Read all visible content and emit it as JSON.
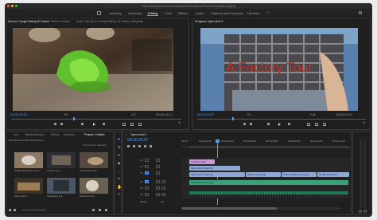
{
  "window": {
    "title": "/Users/Adobe/Documents/Adobe/Premiere Pro/11.0/Untitled.prproj"
  },
  "workspaces": [
    "Learning",
    "Assembly",
    "Editing",
    "Color",
    "Effects",
    "Audio",
    "Captions and Graphics",
    "Libraries"
  ],
  "active_workspace": "Editing",
  "source_panel": {
    "tabs": [
      "Source: Dough Mixing 4K Canon",
      "Effect Controls",
      "Audio Clip Mixer: Dough Mixing 4K Canon",
      "Metadata"
    ],
    "timecode_in": "00;00;06;20",
    "fit": "Fit",
    "scale": "1/2",
    "duration": "00;00;14;17"
  },
  "program_panel": {
    "tab": "Program: Open shot 0",
    "title_overlay": "A Factory Tour",
    "timecode_in": "00;00;03;07",
    "fit": "Fit",
    "scale": "Full",
    "duration": "00;00;15;10"
  },
  "project_panel": {
    "tabs": [
      "Info",
      "Media Browser",
      "Effects",
      "Libraries",
      "Project: Untitled"
    ],
    "path": "Workspaces/Untitled/Media Items",
    "count": "8 of 13 items selected",
    "items": [
      {
        "label": "Dough Mixing 4K Canon",
        "duration": "14;17"
      },
      {
        "label": "Factory Tour_ ...",
        "duration": "5;00"
      },
      {
        "label": "Kneading dough",
        "duration": "8;02"
      },
      {
        "label": "Open shot 0",
        "duration": "15;10"
      },
      {
        "label": "Packaging line",
        "duration": "6;11"
      },
      {
        "label": "Staff interview",
        "duration": "9;05"
      }
    ]
  },
  "timeline": {
    "tab": "Open shot 0",
    "timecode": "00;00;03;07",
    "ruler": [
      "00;00",
      "00;00;02;00",
      "00;00;04;00",
      "00;00;06;00",
      "00;00;08;00",
      "00;00;10;00",
      "00;00;12;00",
      "00;00;14;00"
    ],
    "tracks": [
      {
        "name": "V3"
      },
      {
        "name": "V2"
      },
      {
        "name": "V1"
      },
      {
        "name": "A1"
      },
      {
        "name": "A2"
      },
      {
        "name": "A3"
      }
    ],
    "clips": {
      "title": "A Factory Tour",
      "v2a": "Open shot 0.mp4 [V]",
      "v1a": "Open shot 0.mp4 [V]",
      "v1b": "Pastry making 4K",
      "v1c": "Pastry making 4K Canon",
      "v1d": "Dough Mixing 4K",
      "a1": "Open shot 0.mp4 [A]"
    },
    "master": "Master",
    "master_value": "0.0"
  },
  "colors": {
    "accent": "#4a9fff",
    "video_clip": "#8fa8d6",
    "title_clip": "#c79ad6",
    "audio_clip": "#3ba27a"
  }
}
